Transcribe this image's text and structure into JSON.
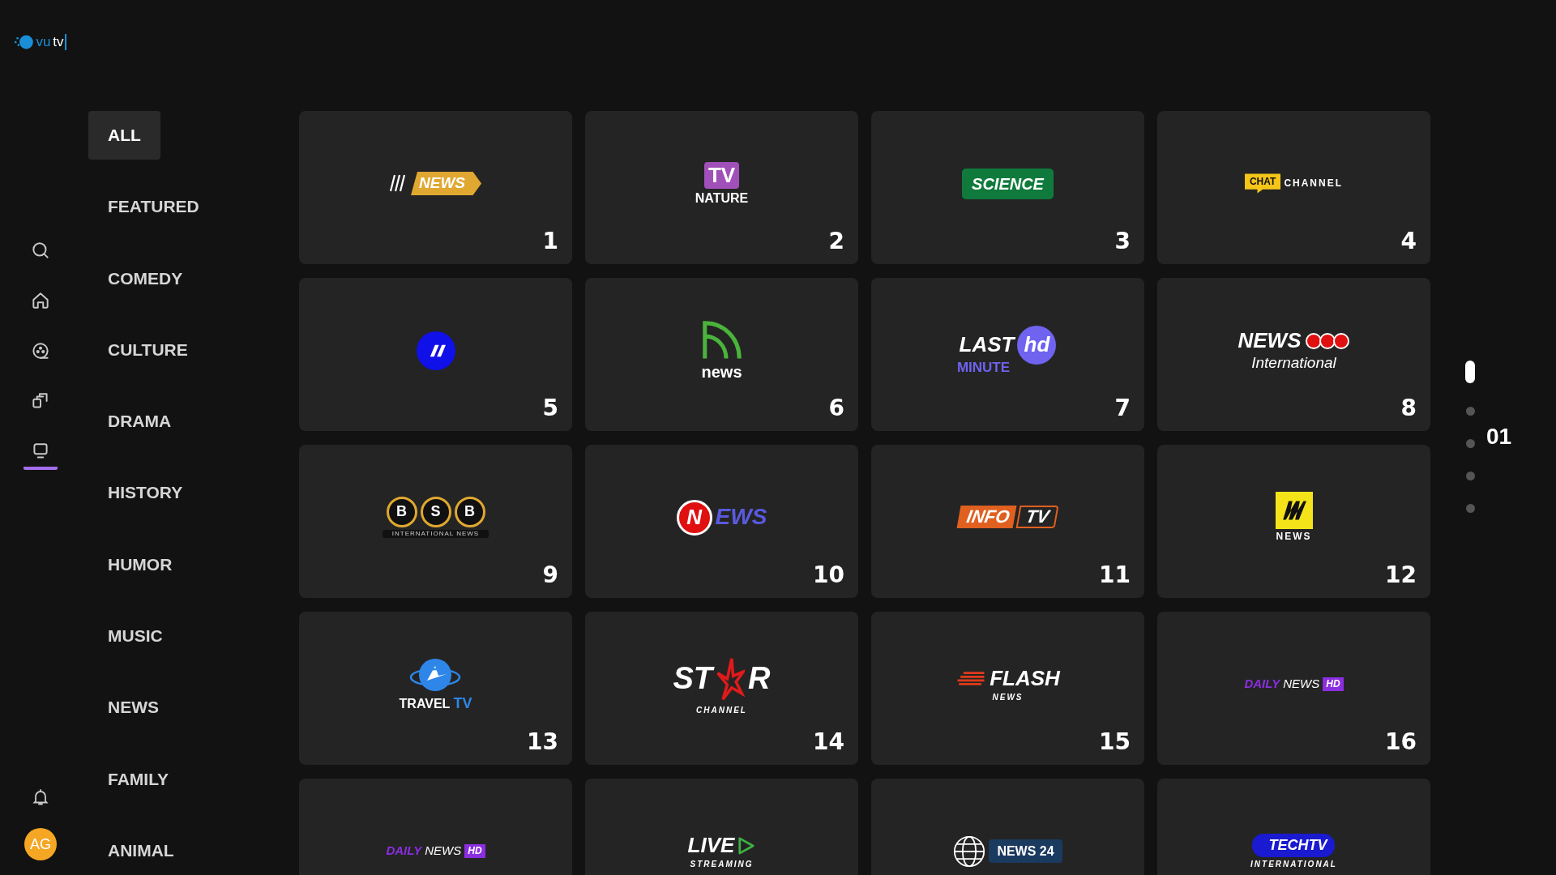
{
  "brand": {
    "text": "vu",
    "suffix": "tv"
  },
  "nav": [
    {
      "selected": false
    },
    {
      "selected": false
    },
    {
      "selected": false
    },
    {
      "selected": false
    },
    {
      "selected": true
    }
  ],
  "nav_bottom": {
    "avatar": "AG"
  },
  "categories": [
    {
      "label": "ALL",
      "selected": true
    },
    {
      "label": "FEATURED",
      "selected": false
    },
    {
      "label": "COMEDY",
      "selected": false
    },
    {
      "label": "CULTURE",
      "selected": false
    },
    {
      "label": "DRAMA",
      "selected": false
    },
    {
      "label": "HISTORY",
      "selected": false
    },
    {
      "label": "HUMOR",
      "selected": false
    },
    {
      "label": "MUSIC",
      "selected": false
    },
    {
      "label": "NEWS",
      "selected": false
    },
    {
      "label": "FAMILY",
      "selected": false
    },
    {
      "label": "ANIMAL",
      "selected": false
    }
  ],
  "channels": [
    {
      "number": "1",
      "logo": [
        [
          {
            "kind": "slashes"
          },
          {
            "kind": "tag-gold",
            "text": "NEWS"
          }
        ]
      ]
    },
    {
      "number": "2",
      "logo": [
        [
          {
            "kind": "tv-box",
            "text": "TV"
          }
        ],
        [
          {
            "kind": "caps",
            "text": "NATURE"
          }
        ]
      ]
    },
    {
      "number": "3",
      "logo": [
        [
          {
            "kind": "pill-green",
            "text": "SCIENCE"
          }
        ]
      ]
    },
    {
      "number": "4",
      "logo": [
        [
          {
            "kind": "tag-yellow",
            "text": "CHAT"
          },
          {
            "kind": "caps-small",
            "text": "CHANNEL"
          }
        ]
      ]
    },
    {
      "number": "5",
      "logo": [
        [
          {
            "kind": "blue-disc"
          }
        ]
      ]
    },
    {
      "number": "6",
      "logo": [
        [
          {
            "kind": "green-arcs"
          }
        ],
        [
          {
            "kind": "word",
            "text": "news"
          }
        ]
      ]
    },
    {
      "number": "7",
      "logo": [
        [
          {
            "kind": "italic",
            "text": "LAST"
          },
          {
            "kind": "disc-purple",
            "text": "hd"
          }
        ],
        [
          {
            "kind": "caps-purple",
            "text": "MINUTE"
          }
        ]
      ]
    },
    {
      "number": "8",
      "logo": [
        [
          {
            "kind": "italic",
            "text": "NEWS"
          },
          {
            "kind": "red-rings"
          }
        ],
        [
          {
            "kind": "italic-light",
            "text": "International"
          }
        ]
      ]
    },
    {
      "number": "9",
      "logo": [
        [
          {
            "kind": "ring-gold",
            "text": "B"
          },
          {
            "kind": "ring-gold",
            "text": "S"
          },
          {
            "kind": "ring-gold",
            "text": "B"
          }
        ],
        [
          {
            "kind": "tiny-bar",
            "text": "INTERNATIONAL NEWS"
          }
        ]
      ]
    },
    {
      "number": "10",
      "logo": [
        [
          {
            "kind": "disc-red",
            "text": "N"
          },
          {
            "kind": "italic-navy",
            "text": "EWS"
          }
        ]
      ]
    },
    {
      "number": "11",
      "logo": [
        [
          {
            "kind": "slant-orange",
            "text": "INFO"
          },
          {
            "kind": "slant-outline",
            "text": "TV"
          }
        ]
      ]
    },
    {
      "number": "12",
      "logo": [
        [
          {
            "kind": "yellow-square"
          }
        ],
        [
          {
            "kind": "caps-small",
            "text": "NEWS"
          }
        ]
      ]
    },
    {
      "number": "13",
      "logo": [
        [
          {
            "kind": "blue-globe"
          }
        ],
        [
          {
            "kind": "caps",
            "text": "TRAVEL"
          },
          {
            "kind": "caps-blue",
            "text": "TV"
          }
        ]
      ]
    },
    {
      "number": "14",
      "logo": [
        [
          {
            "kind": "caps-big",
            "text": "ST"
          },
          {
            "kind": "red-star"
          },
          {
            "kind": "caps-big",
            "text": "R"
          }
        ],
        [
          {
            "kind": "tiny",
            "text": "CHANNEL"
          }
        ]
      ]
    },
    {
      "number": "15",
      "logo": [
        [
          {
            "kind": "speed-lines"
          },
          {
            "kind": "italic",
            "text": "FLASH"
          }
        ],
        [
          {
            "kind": "tiny",
            "text": "NEWS"
          }
        ]
      ]
    },
    {
      "number": "16",
      "logo": [
        [
          {
            "kind": "italic-purple",
            "text": "DAILY"
          },
          {
            "kind": "italic-thin",
            "text": "NEWS"
          },
          {
            "kind": "box-purple",
            "text": "HD"
          }
        ]
      ]
    },
    {
      "logo": [
        [
          {
            "kind": "italic-purple",
            "text": "DAILY"
          },
          {
            "kind": "italic-thin",
            "text": "NEWS"
          },
          {
            "kind": "box-purple",
            "text": "HD"
          }
        ]
      ]
    },
    {
      "logo": [
        [
          {
            "kind": "italic",
            "text": "LIVE"
          },
          {
            "kind": "green-play"
          }
        ],
        [
          {
            "kind": "tiny",
            "text": "STREAMING"
          }
        ]
      ]
    },
    {
      "logo": [
        [
          {
            "kind": "wire-globe"
          },
          {
            "kind": "pill-navy",
            "text": "NEWS 24"
          }
        ]
      ]
    },
    {
      "logo": [
        [
          {
            "kind": "pill-blue",
            "text": "TECHTV"
          }
        ],
        [
          {
            "kind": "tiny",
            "text": "INTERNATIONAL"
          }
        ]
      ]
    }
  ],
  "pager": {
    "pages": [
      {
        "selected": true
      },
      {
        "selected": false
      },
      {
        "selected": false
      },
      {
        "selected": false
      },
      {
        "selected": false
      }
    ],
    "label": "01"
  }
}
